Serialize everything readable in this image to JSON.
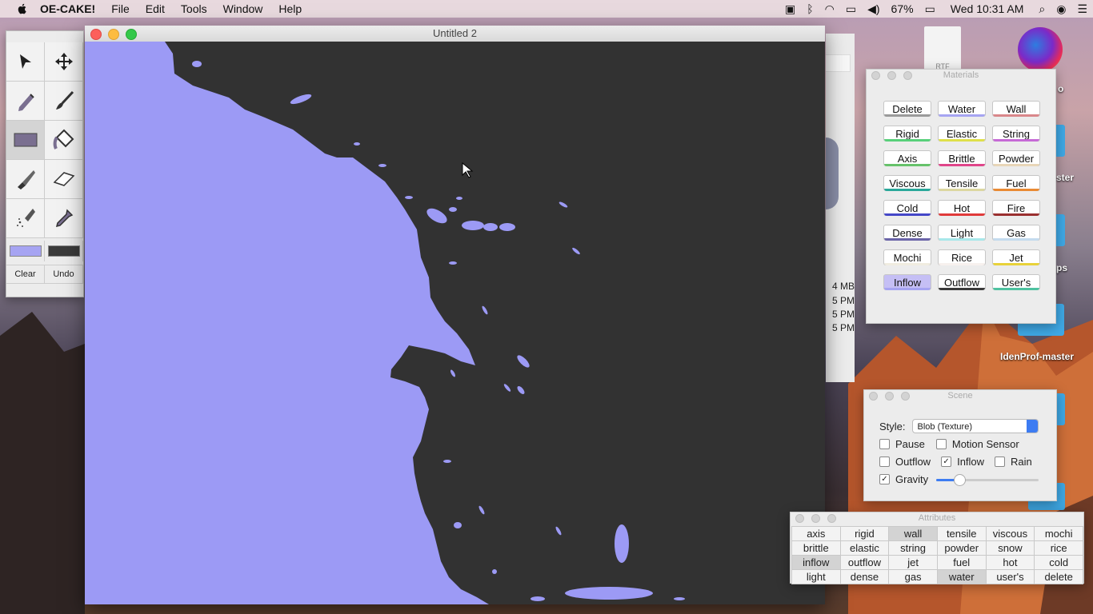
{
  "menubar": {
    "app_name": "OE-CAKE!",
    "menus": [
      "File",
      "Edit",
      "Tools",
      "Window",
      "Help"
    ],
    "battery": "67%",
    "clock": "Wed 10:31 AM"
  },
  "palette": {
    "tools": [
      "select-arrow-icon",
      "move-icon",
      "pencil-icon",
      "brush-icon",
      "rectangle-icon",
      "fill-bucket-icon",
      "knife-icon",
      "eraser-icon",
      "spray-icon",
      "eyedropper-icon"
    ],
    "swatch_colors": [
      "#a6a4f2",
      "#3a3a3a"
    ],
    "clear_label": "Clear",
    "undo_label": "Undo"
  },
  "main_window": {
    "title": "Untitled 2",
    "fluid_color": "#9c9af5",
    "background_color": "#323232"
  },
  "background_window": {
    "size_text": "4 MB",
    "times": [
      "5 PM",
      "5 PM",
      "5 PM"
    ]
  },
  "desktop": {
    "labels": [
      "o",
      "ster",
      "ps",
      "IdenProf-master"
    ],
    "file_label": "RTF"
  },
  "materials": {
    "title": "Materials",
    "items": [
      {
        "label": "Delete",
        "color": "#9a9a9a",
        "selected": false
      },
      {
        "label": "Water",
        "color": "#a6a4f2",
        "selected": false
      },
      {
        "label": "Wall",
        "color": "#d9878a",
        "selected": false
      },
      {
        "label": "Rigid",
        "color": "#58d07a",
        "selected": false
      },
      {
        "label": "Elastic",
        "color": "#dfe04a",
        "selected": false
      },
      {
        "label": "String",
        "color": "#c66ad6",
        "selected": false
      },
      {
        "label": "Axis",
        "color": "#66c26a",
        "selected": false
      },
      {
        "label": "Brittle",
        "color": "#e0458a",
        "selected": false
      },
      {
        "label": "Powder",
        "color": "#e8d6b8",
        "selected": false
      },
      {
        "label": "Viscous",
        "color": "#2aa89a",
        "selected": false
      },
      {
        "label": "Tensile",
        "color": "#dcd7a0",
        "selected": false
      },
      {
        "label": "Fuel",
        "color": "#e98a34",
        "selected": false
      },
      {
        "label": "Cold",
        "color": "#4447c8",
        "selected": false
      },
      {
        "label": "Hot",
        "color": "#e03a3a",
        "selected": false
      },
      {
        "label": "Fire",
        "color": "#9a3030",
        "selected": false
      },
      {
        "label": "Dense",
        "color": "#6a64a8",
        "selected": false
      },
      {
        "label": "Light",
        "color": "#a8e8ea",
        "selected": false
      },
      {
        "label": "Gas",
        "color": "#c4dbee",
        "selected": false
      },
      {
        "label": "Mochi",
        "color": "#f0ece0",
        "selected": false
      },
      {
        "label": "Rice",
        "color": "#f7f1ee",
        "selected": false
      },
      {
        "label": "Jet",
        "color": "#e8d23a",
        "selected": false
      },
      {
        "label": "Inflow",
        "color": "#a6a4f2",
        "selected": true
      },
      {
        "label": "Outflow",
        "color": "#3a3a3a",
        "selected": false
      },
      {
        "label": "User's",
        "color": "#4ec2a0",
        "selected": false
      }
    ]
  },
  "scene": {
    "title": "Scene",
    "style_label": "Style:",
    "style_value": "Blob (Texture)",
    "pause_label": "Pause",
    "pause_checked": false,
    "motion_sensor_label": "Motion Sensor",
    "motion_sensor_checked": false,
    "outflow_label": "Outflow",
    "outflow_checked": false,
    "inflow_label": "Inflow",
    "inflow_checked": true,
    "rain_label": "Rain",
    "rain_checked": false,
    "gravity_label": "Gravity",
    "gravity_checked": true,
    "gravity_level": 0.22
  },
  "attributes": {
    "title": "Attributes",
    "rows": [
      [
        "axis",
        "rigid",
        "wall",
        "tensile",
        "viscous",
        "mochi"
      ],
      [
        "brittle",
        "elastic",
        "string",
        "powder",
        "snow",
        "rice"
      ],
      [
        "inflow",
        "outflow",
        "jet",
        "fuel",
        "hot",
        "cold"
      ],
      [
        "light",
        "dense",
        "gas",
        "water",
        "user's",
        "delete"
      ]
    ],
    "selected": [
      "wall",
      "inflow",
      "water"
    ]
  }
}
